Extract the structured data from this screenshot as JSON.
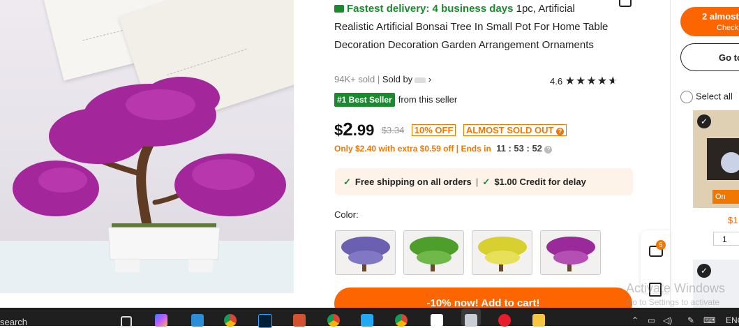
{
  "product": {
    "fastest_delivery": "Fastest delivery: 4 business days",
    "title": "1pc, Artificial Realistic Artificial Bonsai Tree In Small Pot For Home Table Decoration Decoration Garden Arrangement Ornaments",
    "sold": "94K+ sold",
    "sold_by": "Sold by",
    "rating": "4.6",
    "stars_shown": 4.5,
    "best_seller_badge": "#1 Best Seller",
    "best_seller_suffix": "from this seller",
    "price_symbol": "$",
    "price_whole": "2",
    "price_fraction": ".99",
    "original_price": "$3.34",
    "discount_tag": "10% OFF",
    "almost_sold_out": "ALMOST SOLD OUT",
    "promo_text": "Only $2.40 with extra $0.59 off",
    "ends_in_label": "Ends in",
    "countdown": "11 : 53 : 52",
    "free_shipping": "Free shipping on all orders",
    "credit_delay": "$1.00 Credit for delay",
    "color_label": "Color:",
    "swatches": [
      {
        "name": "Purple-blue",
        "color": "#6a5fb0"
      },
      {
        "name": "Green",
        "color": "#4e9e2c"
      },
      {
        "name": "Yellow",
        "color": "#d8d030"
      },
      {
        "name": "Purple",
        "color": "#9a2a9a"
      }
    ],
    "add_to_cart": "-10% now! Add to cart!",
    "chat_badge": "5",
    "image_colors": {
      "blossom": "#a3269b",
      "trunk": "#5e3b22",
      "pot": "#f7f7f7"
    }
  },
  "cart_panel": {
    "checkout_line1": "2 almost",
    "checkout_line2": "Check",
    "goto_label": "Go to",
    "select_all": "Select all",
    "item_badge": "On",
    "item_price": "$1",
    "quantity": "1"
  },
  "watermark": {
    "line1": "Activate Windows",
    "line2": "Go to Settings to activate"
  },
  "taskbar": {
    "search_text": "search",
    "language": "ENG",
    "icons": [
      "task-view-icon",
      "copilot-icon",
      "files-icon",
      "chrome-icon",
      "photoshop-icon",
      "office-icon",
      "chrome-icon",
      "vscode-icon",
      "chrome-icon",
      "capcut-icon",
      "app-icon",
      "opera-icon",
      "explorer-icon"
    ]
  },
  "accent_color": "#fd6500",
  "green_color": "#1a8a2e"
}
